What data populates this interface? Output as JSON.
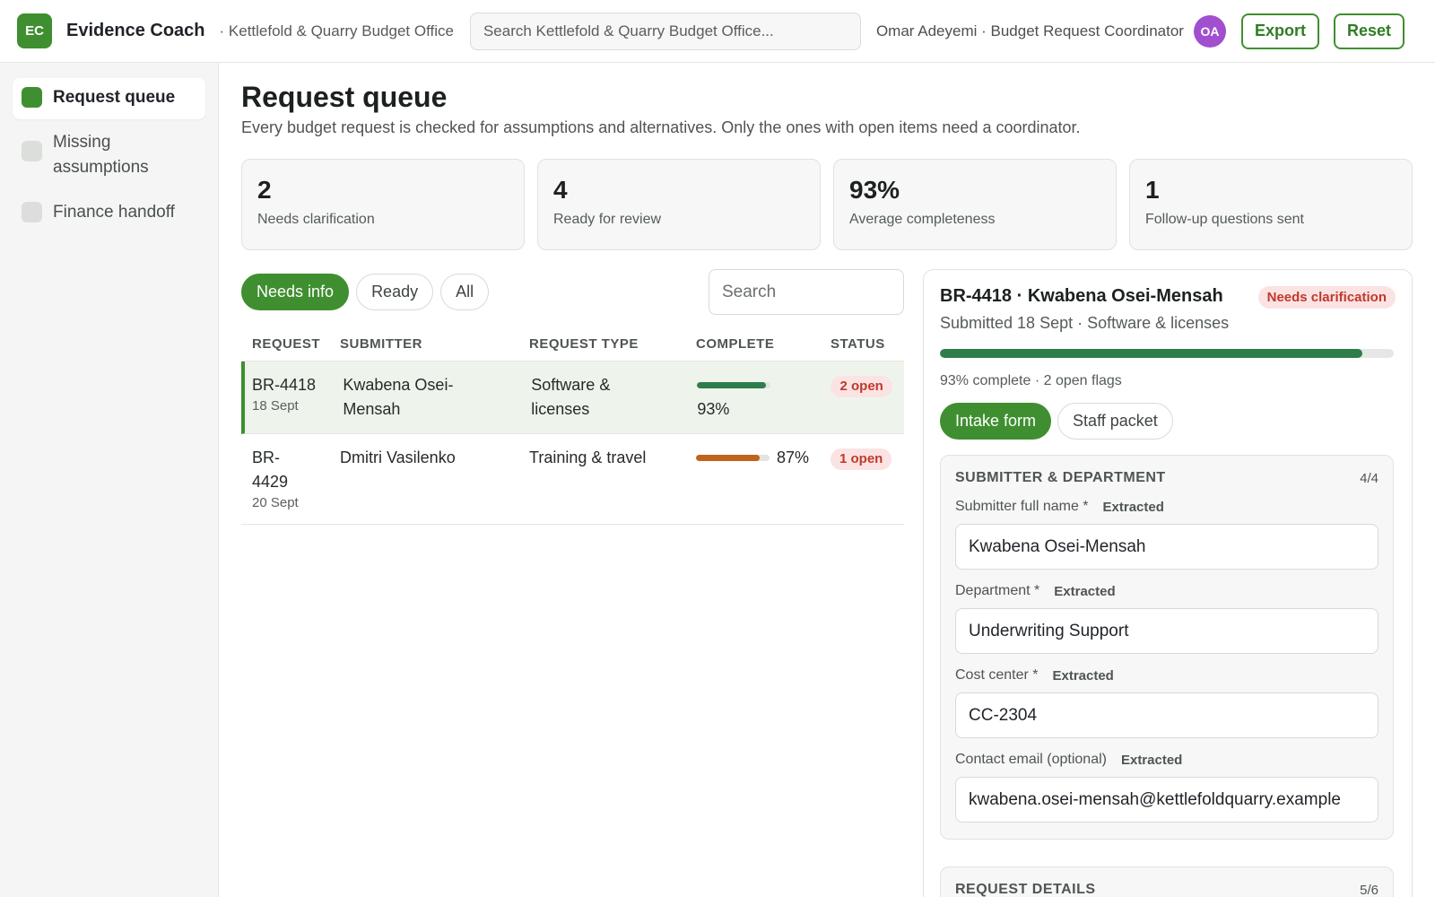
{
  "header": {
    "logo": "EC",
    "app_name": "Evidence Coach",
    "org": "· Kettlefold & Quarry Budget Office",
    "search_placeholder": "Search Kettlefold & Quarry Budget Office...",
    "user": "Omar Adeyemi · Budget Request Coordinator",
    "avatar": "OA",
    "export_label": "Export",
    "reset_label": "Reset"
  },
  "sidebar": {
    "items": [
      {
        "label": "Request queue",
        "active": true
      },
      {
        "label": "Missing assumptions",
        "active": false
      },
      {
        "label": "Finance handoff",
        "active": false
      }
    ]
  },
  "main": {
    "title": "Request queue",
    "subtitle": "Every budget request is checked for assumptions and alternatives. Only the ones with open items need a coordinator.",
    "stats": [
      {
        "value": "2",
        "label": "Needs clarification"
      },
      {
        "value": "4",
        "label": "Ready for review"
      },
      {
        "value": "93%",
        "label": "Average completeness"
      },
      {
        "value": "1",
        "label": "Follow-up questions sent"
      }
    ],
    "filters": [
      "Needs info",
      "Ready",
      "All"
    ],
    "search_placeholder": "Search",
    "columns": [
      "REQUEST",
      "SUBMITTER",
      "REQUEST TYPE",
      "COMPLETE",
      "STATUS"
    ],
    "rows": [
      {
        "id": "BR-4418",
        "date": "18 Sept",
        "submitter": "Kwabena Osei-Mensah",
        "type": "Software & licenses",
        "complete": "93%",
        "complete_value": 0.93,
        "bar_color": "#2f7d4a",
        "status": "2 open"
      },
      {
        "id": "BR-4429",
        "date": "20 Sept",
        "submitter": "Dmitri Vasilenko",
        "type": "Training & travel",
        "complete": "87%",
        "complete_value": 0.87,
        "bar_color": "#c0641c",
        "status": "1 open"
      }
    ]
  },
  "detail": {
    "title": "BR-4418 · Kwabena Osei-Mensah",
    "badge": "Needs clarification",
    "subtitle": "Submitted 18 Sept · Software & licenses",
    "progress_value": 0.93,
    "progress_text": "93% complete · 2 open flags",
    "tabs": [
      "Intake form",
      "Staff packet"
    ],
    "section1": {
      "title": "SUBMITTER & DEPARTMENT",
      "count": "4/4",
      "fields": [
        {
          "label": "Submitter full name *",
          "tag": "Extracted",
          "value": "Kwabena Osei-Mensah"
        },
        {
          "label": "Department *",
          "tag": "Extracted",
          "value": "Underwriting Support"
        },
        {
          "label": "Cost center *",
          "tag": "Extracted",
          "value": "CC-2304"
        },
        {
          "label": "Contact email (optional)",
          "tag": "Extracted",
          "value": "kwabena.osei-mensah@kettlefoldquarry.example"
        }
      ]
    },
    "section2": {
      "title": "REQUEST DETAILS",
      "count": "5/6"
    }
  }
}
